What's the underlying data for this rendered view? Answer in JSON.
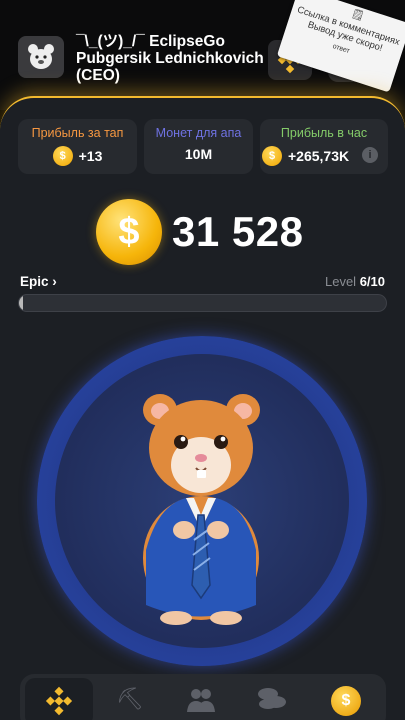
{
  "header": {
    "username": "¯\\_(ツ)_/¯ EclipseGo Pubgersik Lednichkovich (CEO)"
  },
  "sticker": {
    "line1": "Ссылка в комментариях",
    "line2": "Вывод уже скоро!",
    "line3": "ответ"
  },
  "stats": [
    {
      "label": "Прибыль за тап",
      "value": "+13",
      "label_color": "#f79841",
      "has_coin": true
    },
    {
      "label": "Монет для апа",
      "value": "10M",
      "label_color": "#6f72e2",
      "has_coin": false
    },
    {
      "label": "Прибыль в час",
      "value": "+265,73K",
      "label_color": "#84cb69",
      "has_coin": true
    }
  ],
  "balance": {
    "value": "31 528",
    "coin_symbol": "$"
  },
  "league": {
    "name": "Epic",
    "level_label": "Level",
    "level_value": "6/10",
    "progress_fraction": 0.01
  },
  "nav": {
    "items": [
      "exchange-icon",
      "pickaxe-icon",
      "friends-icon",
      "coins-icon",
      "airdrop-coin-icon"
    ],
    "active_index": 0
  },
  "colors": {
    "accent": "#f3ba2f",
    "panel": "#1c1f24",
    "card": "#272a2f",
    "tap_circle": "#27429d"
  }
}
